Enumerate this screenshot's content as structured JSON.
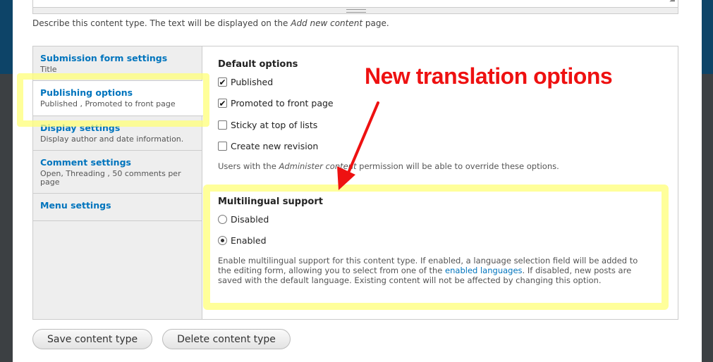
{
  "description": {
    "prefix": "Describe this content type. The text will be displayed on the ",
    "emphasis": "Add new content",
    "suffix": " page."
  },
  "vertical_tabs": [
    {
      "title": "Submission form settings",
      "summary": "Title"
    },
    {
      "title": "Publishing options",
      "summary": "Published , Promoted to front page"
    },
    {
      "title": "Display settings",
      "summary": "Display author and date information."
    },
    {
      "title": "Comment settings",
      "summary": "Open, Threading , 50 comments per page"
    },
    {
      "title": "Menu settings",
      "summary": ""
    }
  ],
  "default_options": {
    "legend": "Default options",
    "options": [
      {
        "label": "Published",
        "checked": true
      },
      {
        "label": "Promoted to front page",
        "checked": true
      },
      {
        "label": "Sticky at top of lists",
        "checked": false
      },
      {
        "label": "Create new revision",
        "checked": false
      }
    ],
    "help_prefix": "Users with the ",
    "help_emphasis": "Administer content",
    "help_suffix": " permission will be able to override these options."
  },
  "multilingual": {
    "legend": "Multilingual support",
    "options": [
      {
        "label": "Disabled",
        "selected": false
      },
      {
        "label": "Enabled",
        "selected": true
      }
    ],
    "help_prefix": "Enable multilingual support for this content type. If enabled, a language selection field will be added to the editing form, allowing you to select from one of the ",
    "help_link": "enabled languages",
    "help_suffix": ". If disabled, new posts are saved with the default language. Existing content will not be affected by changing this option."
  },
  "callout": "New translation options",
  "buttons": {
    "save": "Save content type",
    "delete": "Delete content type"
  },
  "colors": {
    "link": "#0074bd",
    "highlight": "#ffff78",
    "callout": "#ee1111"
  }
}
